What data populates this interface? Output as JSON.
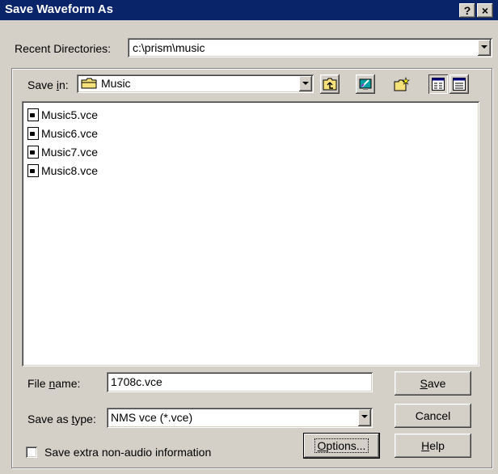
{
  "window": {
    "title": "Save Waveform As",
    "help_glyph": "?",
    "close_glyph": "×"
  },
  "recent": {
    "label": "Recent Directories:",
    "value": "c:\\prism\\music"
  },
  "save_in": {
    "label_pre": "Save ",
    "label_accel": "i",
    "label_post": "n:",
    "value": "Music"
  },
  "toolbar": {
    "up_icon": "up-one-level-icon",
    "desktop_icon": "desktop-icon",
    "new_folder_icon": "new-folder-icon",
    "list_icon": "list-view-icon",
    "details_icon": "details-view-icon"
  },
  "files": [
    {
      "name": "Music5.vce"
    },
    {
      "name": "Music6.vce"
    },
    {
      "name": "Music7.vce"
    },
    {
      "name": "Music8.vce"
    }
  ],
  "filename": {
    "label_pre": "File ",
    "label_accel": "n",
    "label_post": "ame:",
    "value": "1708c.vce"
  },
  "filetype": {
    "label_pre": "Save as ",
    "label_accel": "t",
    "label_post": "ype:",
    "value": "NMS vce (*.vce)"
  },
  "buttons": {
    "save_accel": "S",
    "save_post": "ave",
    "cancel": "Cancel",
    "options_accel": "O",
    "options_post": "ptions...",
    "help_accel": "H",
    "help_post": "elp"
  },
  "checkbox": {
    "label": "Save extra non-audio information",
    "checked": false
  }
}
